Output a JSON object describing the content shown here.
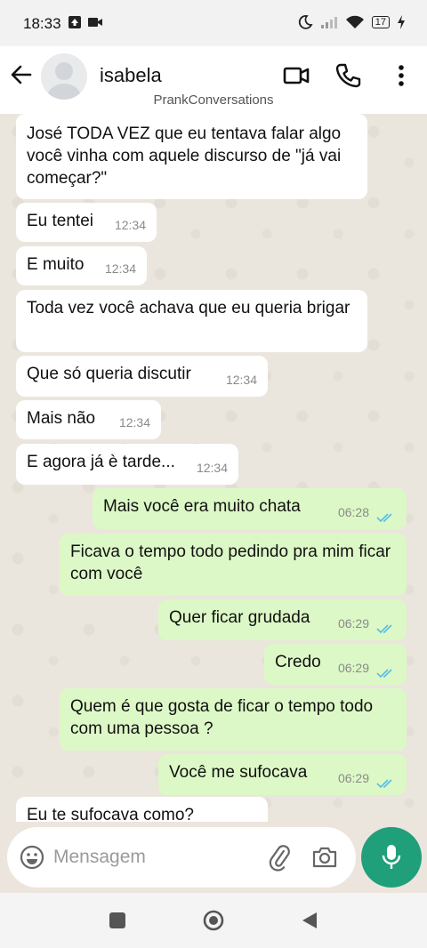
{
  "status_bar": {
    "time": "18:33",
    "battery": "17"
  },
  "header": {
    "contact_name": "isabela",
    "watermark": "PrankConversations"
  },
  "messages": [
    {
      "dir": "in",
      "text": "José TODA VEZ que eu tentava falar algo você vinha com aquele discurso de \"já vai começar?\"",
      "time": ""
    },
    {
      "dir": "in",
      "text": "Eu tentei",
      "time": "12:34"
    },
    {
      "dir": "in",
      "text": "E muito",
      "time": "12:34"
    },
    {
      "dir": "in",
      "text": "Toda vez você achava que eu queria brigar",
      "time": ""
    },
    {
      "dir": "in",
      "text": "Que só queria discutir",
      "time": "12:34"
    },
    {
      "dir": "in",
      "text": "Mais não",
      "time": "12:34"
    },
    {
      "dir": "in",
      "text": "E agora já è tarde...",
      "time": "12:34"
    },
    {
      "dir": "out",
      "text": "Mais você era muito chata",
      "time": "06:28"
    },
    {
      "dir": "out",
      "text": "Ficava o tempo todo pedindo pra mim ficar com você",
      "time": ""
    },
    {
      "dir": "out",
      "text": "Quer ficar grudada",
      "time": "06:29"
    },
    {
      "dir": "out",
      "text": "Credo",
      "time": "06:29"
    },
    {
      "dir": "out",
      "text": "Quem é que gosta de ficar o tempo todo com uma pessoa ?",
      "time": ""
    },
    {
      "dir": "out",
      "text": "Você me sufocava",
      "time": "06:29"
    },
    {
      "dir": "in",
      "text": "Eu te sufocava como?",
      "time": ""
    }
  ],
  "composer": {
    "placeholder": "Mensagem"
  },
  "colors": {
    "incoming": "#ffffff",
    "outgoing": "#dcf8c6",
    "accent": "#1f9f7a",
    "read_ticks": "#53bdeb"
  }
}
